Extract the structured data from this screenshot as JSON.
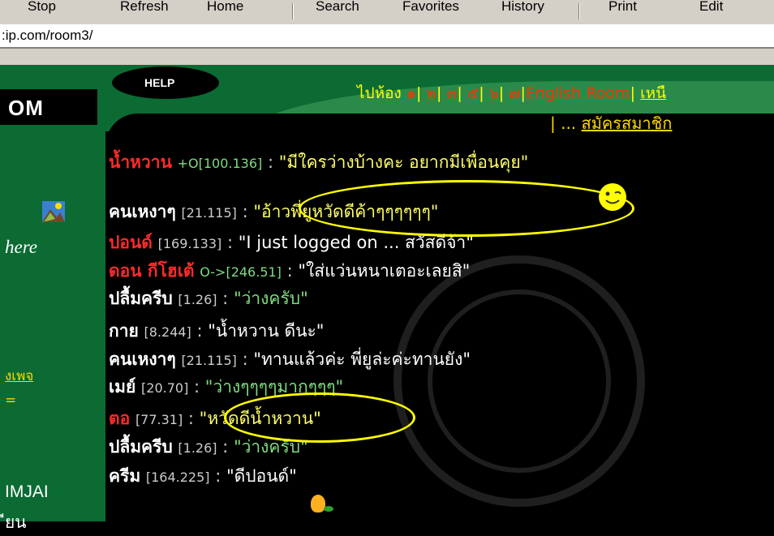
{
  "toolbar": {
    "buttons": [
      "Stop",
      "Refresh",
      "Home",
      "Search",
      "Favorites",
      "History",
      "Print",
      "Edit"
    ]
  },
  "address": {
    "url": ":ip.com/room3/"
  },
  "sidebar": {
    "logo": "OM",
    "here": "here",
    "link1": "งเพจ",
    "link2": "=",
    "imjai": "IMJAI",
    "yuan": "ียน"
  },
  "header": {
    "help": "HELP",
    "rooms_prefix": "ไปห้อง",
    "rooms": [
      "๑",
      "๒",
      "๓",
      "๕",
      "๖",
      "๗"
    ],
    "english_room": "English Room",
    "more": "เหนื",
    "member_prefix": "| ... ",
    "member": "สมัครสมาชิก"
  },
  "chat": [
    {
      "nick": "น้ำหวาน",
      "ip": "+O[100.136]",
      "msg": "\"มีใครว่างบ้างคะ อยากมีเพื่อนคุย\""
    },
    {
      "nick": "คนเหงาๆ",
      "ip": "[21.115]",
      "msg": "\"อ้าวพี่ยูหวัดดีค้าๆๆๆๆๆๆ\""
    },
    {
      "nick": "ปอนด์",
      "ip": "[169.133]",
      "msg": "\"I just logged on ... สวัสดีจ้า\""
    },
    {
      "nick": "ดอน กีโฮเต้",
      "ip": "O->[246.51]",
      "msg": "\"ใส่แว่นหนาเตอะเลยสิ\""
    },
    {
      "nick": "ปลื้มครีบ",
      "ip": "[1.26]",
      "msg": "\"ว่างครับ\""
    },
    {
      "nick": "กาย",
      "ip": "[8.244]",
      "msg": "\"น้ำหวาน ดีนะ\""
    },
    {
      "nick": "คนเหงาๆ",
      "ip": "[21.115]",
      "msg": "\"ทานแล้วค่ะ พี่ยูล่ะค่ะทานยัง\""
    },
    {
      "nick": "เมย์",
      "ip": "[20.70]",
      "msg": "\"ว่างๆๆๆๆมากๆๆๆ\""
    },
    {
      "nick": "ตอ",
      "ip": "[77.31]",
      "msg": "\"หวัดดีน้ำหวาน\""
    },
    {
      "nick": "ปลื้มครีบ",
      "ip": "[1.26]",
      "msg": "\"ว่างครับ\""
    },
    {
      "nick": "ครีม",
      "ip": "[164.225]",
      "msg": "\"ดีปอนด์\""
    }
  ],
  "colon": " : ",
  "colors": {
    "accent": "#ffff00",
    "nick_red": "#ff2a2a",
    "bg_green": "#0b6b33"
  }
}
